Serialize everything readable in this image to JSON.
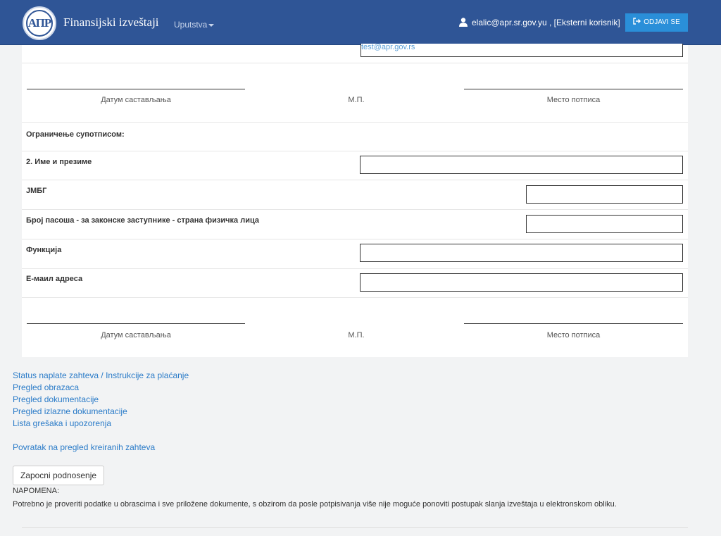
{
  "header": {
    "logo_text": "АПР",
    "brand": "Finansijski izveštaji",
    "menu_label": "Uputstva",
    "user": "elalic@apr.sr.gov.yu , [Eksterni korisnik]",
    "logout_label": "ODJAVI SE"
  },
  "form": {
    "top_email_value": "test@apr.gov.rs",
    "signature1": {
      "date_label": "Датум састављања",
      "stamp_label": "М.П.",
      "sign_label": "Место потписа"
    },
    "restriction_label": "Ограничење супотписом:",
    "fields": {
      "name_label": "2. Име и презиме",
      "name_value": "",
      "jmbg_label": "ЈМБГ",
      "jmbg_value": "",
      "passport_label": "Број пасоша - за законске заступнике - страна физичка лица",
      "passport_value": "",
      "function_label": "Функција",
      "function_value": "",
      "email_label": "Е-маил адреса",
      "email_value": ""
    },
    "signature2": {
      "date_label": "Датум састављања",
      "stamp_label": "М.П.",
      "sign_label": "Место потписа"
    }
  },
  "links": {
    "payment_status": "Status naplate zahteva / Instrukcije za plaćanje",
    "forms_review": "Pregled obrazaca",
    "docs_review": "Pregled dokumentacije",
    "output_docs_review": "Pregled izlazne dokumentacije",
    "errors_list": "Lista grešaka i upozorenja",
    "back": "Povratak na pregled kreiranih zahteva"
  },
  "actions": {
    "start_submission": "Zapocni podnosenje"
  },
  "note": {
    "title": "NAPOMENA:",
    "text": "Potrebno je proveriti podatke u obrascima i sve priložene dokumente, s obzirom da posle potpisivanja više nije moguće ponoviti postupak slanja izveštaja u elektronskom obliku."
  }
}
